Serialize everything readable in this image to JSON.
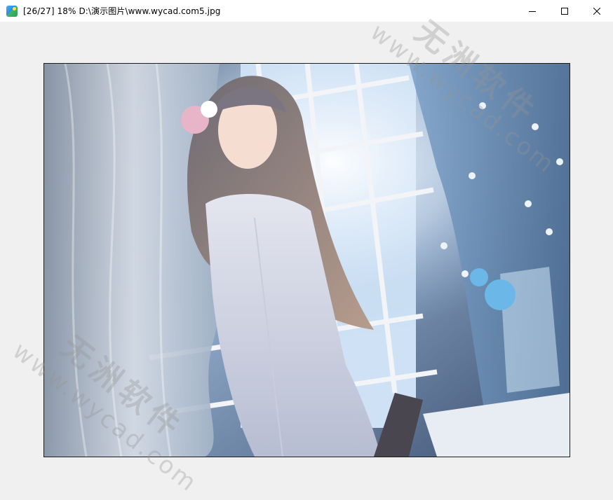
{
  "window": {
    "title": "[26/27] 18% D:\\演示图片\\www.wycad.com5.jpg",
    "app_icon": "image-viewer-icon",
    "controls": {
      "minimize": "minimize-icon",
      "maximize": "maximize-icon",
      "close": "close-icon"
    }
  },
  "watermark": {
    "brand": "无洲软件",
    "url": "www.wycad.com"
  },
  "colors": {
    "titlebar": "#ffffff",
    "viewer_background": "#f0f0f0",
    "photo_border": "#1c1c1c"
  }
}
